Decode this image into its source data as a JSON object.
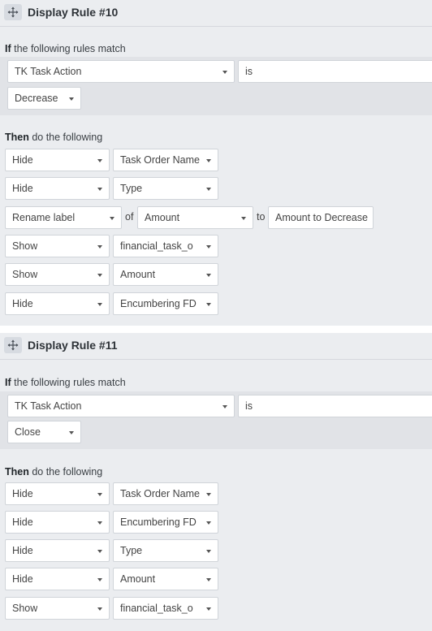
{
  "rules": [
    {
      "title": "Display Rule #10",
      "if_prefix": "If",
      "if_rest": " the following rules match",
      "condition": {
        "field": "TK Task Action",
        "operator": "is",
        "value": "Decrease"
      },
      "then_prefix": "Then",
      "then_rest": " do the following",
      "actions": [
        {
          "action": "Hide",
          "target": "Task Order Name"
        },
        {
          "action": "Hide",
          "target": "Type"
        },
        {
          "action": "Rename label",
          "of_word": "of",
          "target": "Amount",
          "to_word": "to",
          "new_label": "Amount to Decrease"
        },
        {
          "action": "Show",
          "target": "financial_task_o"
        },
        {
          "action": "Show",
          "target": "Amount"
        },
        {
          "action": "Hide",
          "target": "Encumbering FD"
        }
      ]
    },
    {
      "title": "Display Rule #11",
      "if_prefix": "If",
      "if_rest": " the following rules match",
      "condition": {
        "field": "TK Task Action",
        "operator": "is",
        "value": "Close"
      },
      "then_prefix": "Then",
      "then_rest": " do the following",
      "actions": [
        {
          "action": "Hide",
          "target": "Task Order Name"
        },
        {
          "action": "Hide",
          "target": "Encumbering FD"
        },
        {
          "action": "Hide",
          "target": "Type"
        },
        {
          "action": "Hide",
          "target": "Amount"
        },
        {
          "action": "Show",
          "target": "financial_task_o"
        }
      ]
    }
  ],
  "icons": {
    "drag_handle": "move-arrows-icon"
  }
}
